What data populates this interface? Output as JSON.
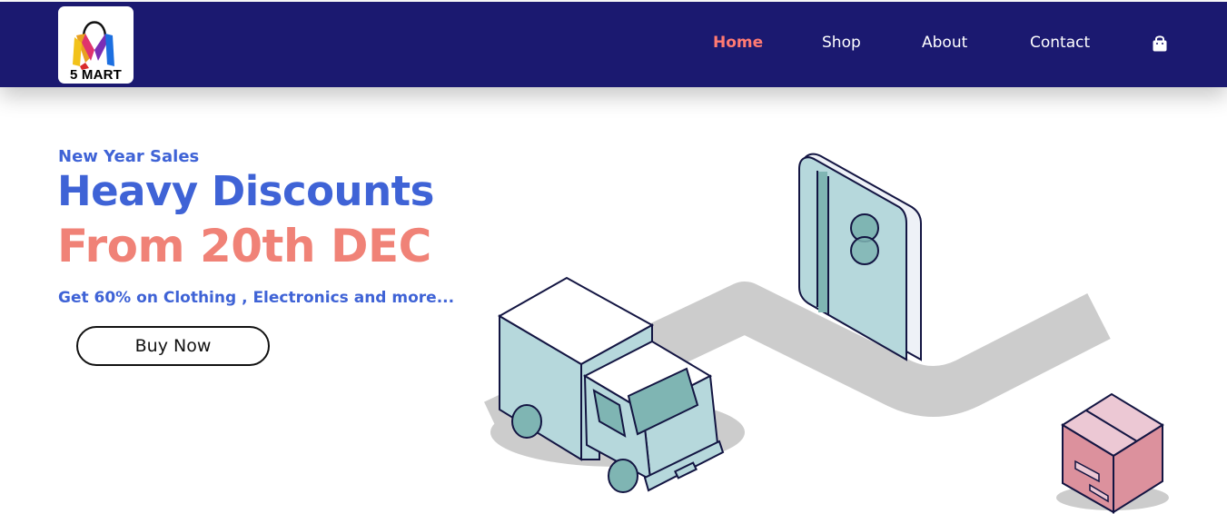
{
  "brand": {
    "logo_text": "5 MART"
  },
  "nav": {
    "links": [
      {
        "label": "Home",
        "active": true
      },
      {
        "label": "Shop",
        "active": false
      },
      {
        "label": "About",
        "active": false
      },
      {
        "label": "Contact",
        "active": false
      }
    ],
    "cart_icon": "shopping-bag-icon"
  },
  "hero": {
    "kicker": "New Year Sales",
    "headline_line1": "Heavy Discounts",
    "headline_line2": "From 20th DEC",
    "offer": "Get 60% on Clothing , Electronics and more...",
    "cta_label": "Buy Now"
  },
  "colors": {
    "navbar": "#1b1970",
    "nav_active": "#ff7a72",
    "primary_blue": "#3f63d6",
    "accent_salmon": "#f08277"
  }
}
